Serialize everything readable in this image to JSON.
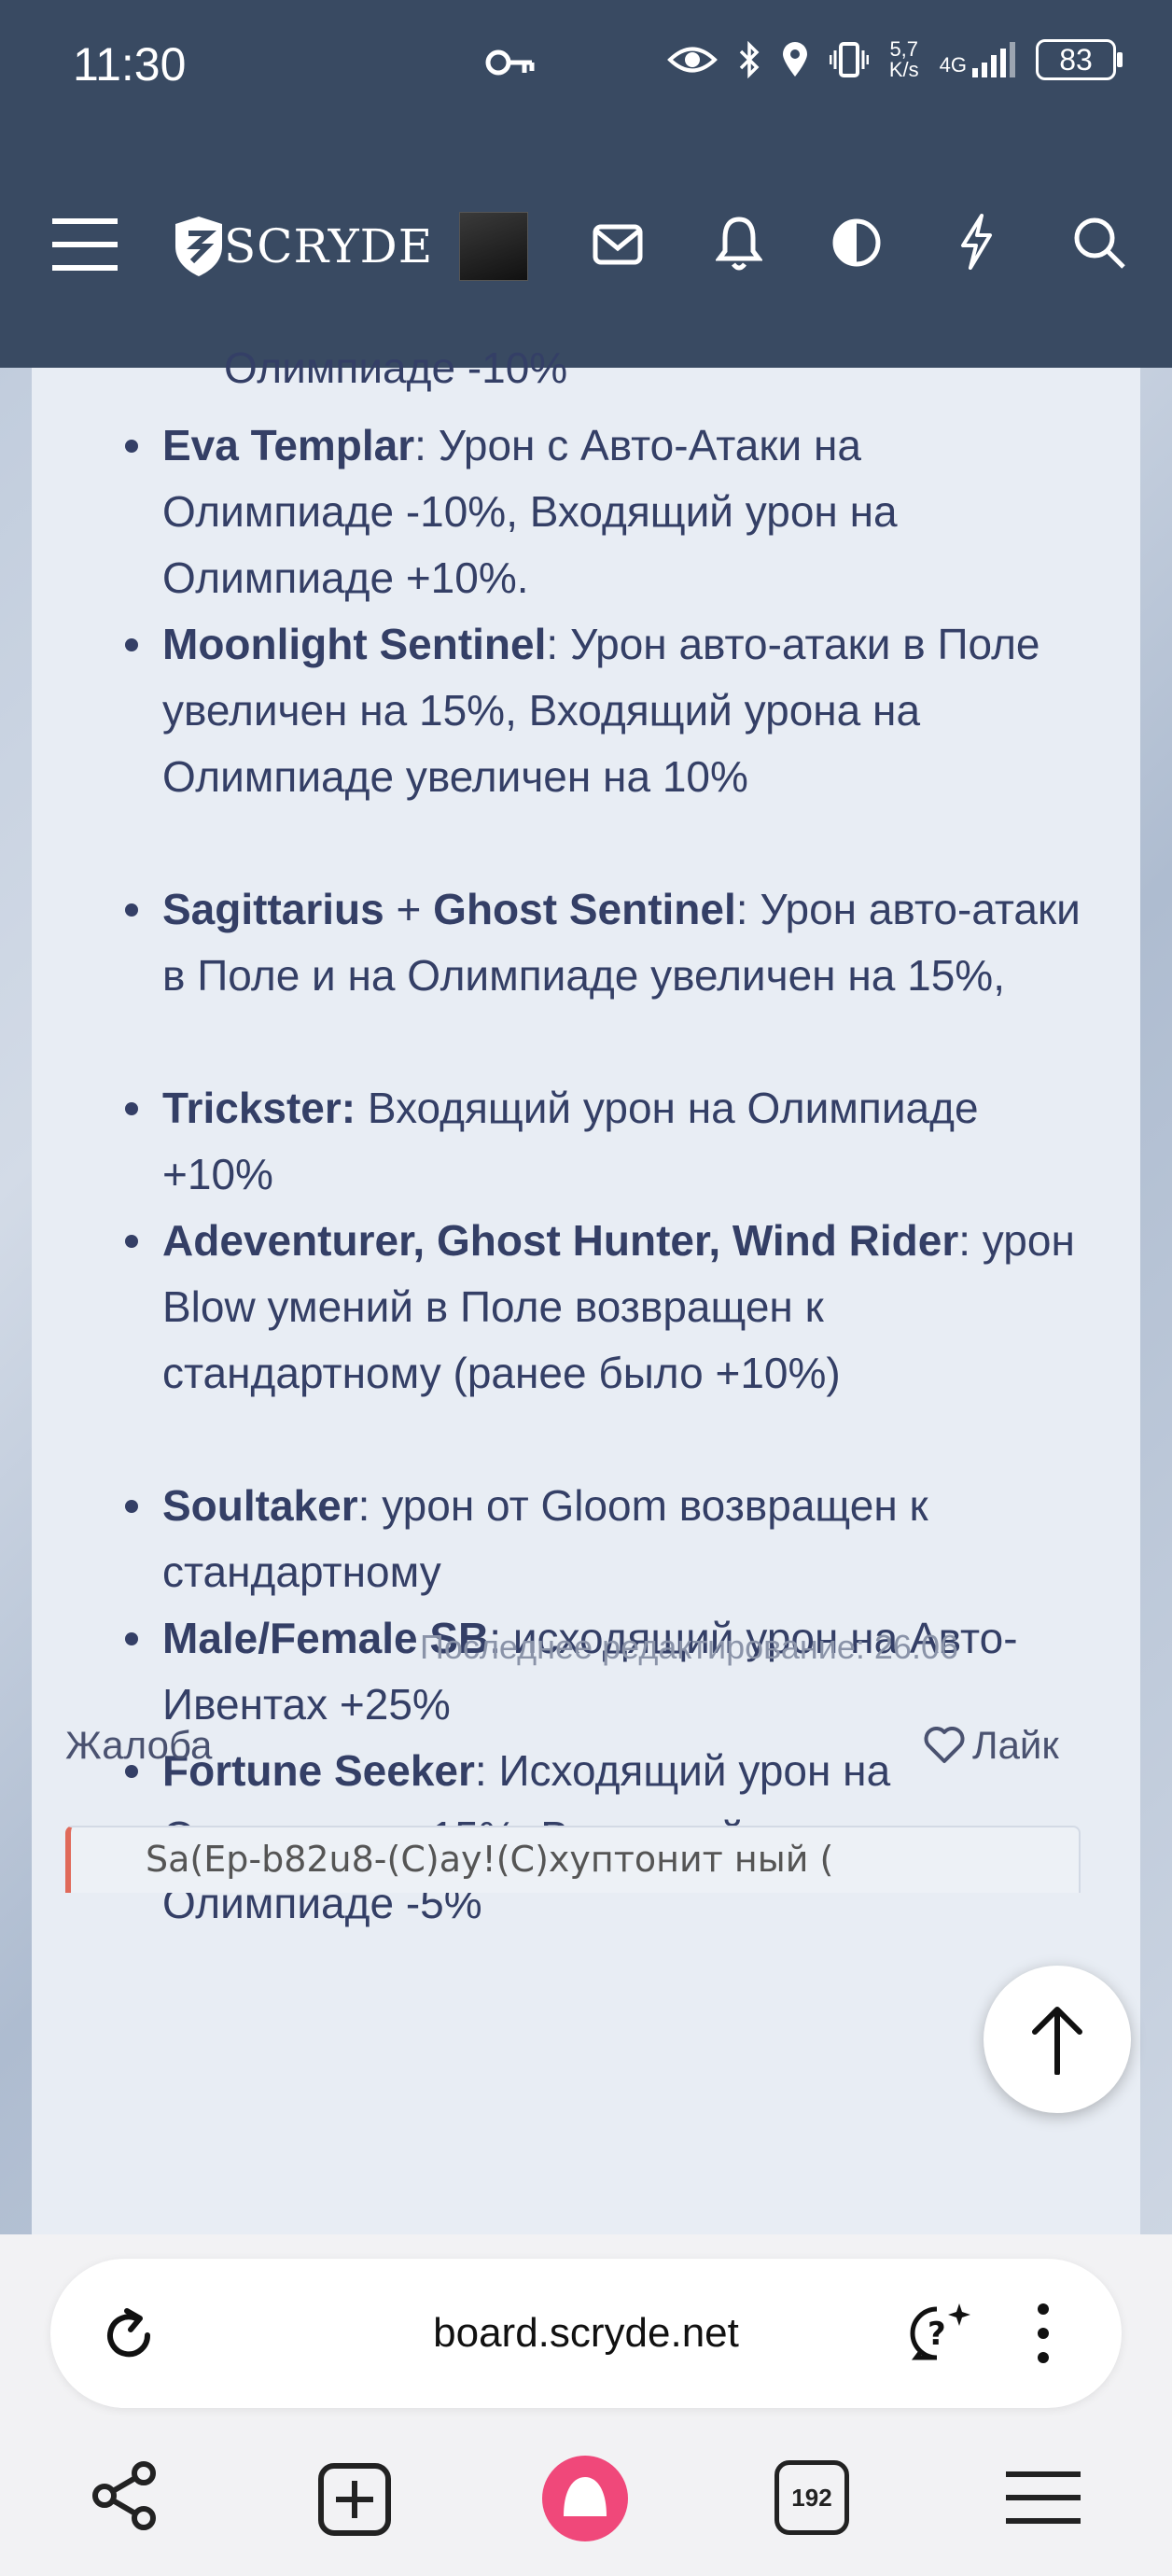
{
  "status_bar": {
    "time": "11:30",
    "net_speed_value": "5,7",
    "net_speed_unit": "K/s",
    "network": "4G",
    "battery": "83"
  },
  "header": {
    "logo_text": "SCRYDE",
    "icons": [
      "menu-icon",
      "mail-icon",
      "bell-icon",
      "contrast-icon",
      "lightning-icon",
      "search-icon"
    ]
  },
  "post": {
    "cut_line": "Олимпиаде -10%",
    "items": [
      {
        "name": "Eva Templar",
        "text": ": Урон с Авто-Атаки на Олимпиаде -10%, Входящий урон на Олимпиаде +10%."
      },
      {
        "name": "Moonlight Sentinel",
        "text": ": Урон авто-атаки в Поле увеличен на 15%, Входящий урона на Олимпиаде увеличен на 10%"
      },
      {
        "name": "Sagittarius",
        "mid": " + ",
        "name2": "Ghost Sentinel",
        "text": ": Урон авто-атаки в Поле и на Олимпиаде увеличен на 15%,"
      },
      {
        "name": "Trickster:",
        "text": " Входящий урон на Олимпиаде +10%"
      },
      {
        "name": "Adeventurer, Ghost Hunter, Wind Rider",
        "text": ": урон Blow умений в Поле возвращен к стандартному (ранее было +10%)"
      },
      {
        "name": "Soultaker",
        "text": ": урон от Gloom возвращен к стандартному"
      },
      {
        "name": "Male/Female SB",
        "text": ": исходящий урон на Авто-Ивентах +25%"
      },
      {
        "name": "Fortune Seeker",
        "text": ": Исходящий урон на Олимпиаде +15%, Входящий урон на Олимпиаде -5%"
      }
    ],
    "last_edit": "Последнее редактирование: 26.06",
    "report_label": "Жалоба",
    "like_label": "Лайк",
    "quote_preview": "Sa(Ep-b82u8-(C)ay!(C)хуптонит ный ("
  },
  "browser": {
    "url": "board.scryde.net",
    "tab_count": "192"
  },
  "colors": {
    "header_bg": "#394a62",
    "post_bg": "#e8edf4",
    "post_text": "#343f66",
    "accent_pink": "#f0487a"
  }
}
